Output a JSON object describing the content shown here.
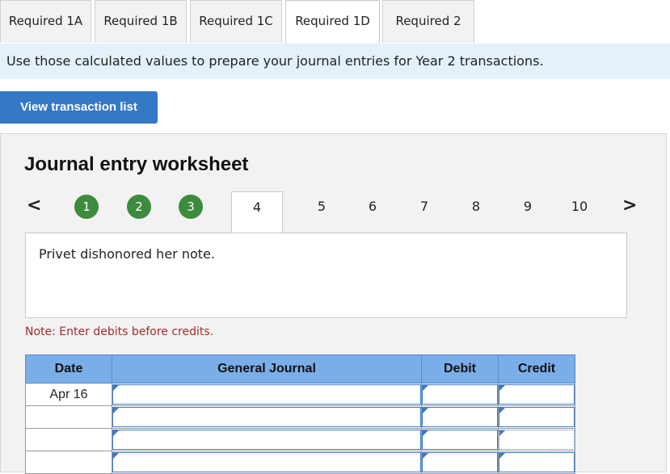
{
  "tabs": [
    "Required 1A",
    "Required 1B",
    "Required 1C",
    "Required 1D",
    "Required 2"
  ],
  "active_tab": "Required 1D",
  "instruction": "Use those calculated values to prepare your journal entries for Year 2 transactions.",
  "view_button_label": "View transaction list",
  "worksheet": {
    "title": "Journal entry worksheet",
    "prev_arrow": "<",
    "next_arrow": ">",
    "steps": [
      "1",
      "2",
      "3",
      "4",
      "5",
      "6",
      "7",
      "8",
      "9",
      "10"
    ],
    "completed_steps": [
      "1",
      "2",
      "3"
    ],
    "current_step": "4",
    "description": "Privet dishonored her note.",
    "note": "Note: Enter debits before credits."
  },
  "table": {
    "headers": [
      "Date",
      "General Journal",
      "Debit",
      "Credit"
    ],
    "rows": [
      {
        "date": "Apr 16",
        "account": "",
        "debit": "",
        "credit": ""
      },
      {
        "date": "",
        "account": "",
        "debit": "",
        "credit": ""
      },
      {
        "date": "",
        "account": "",
        "debit": "",
        "credit": ""
      },
      {
        "date": "",
        "account": "",
        "debit": "",
        "credit": ""
      }
    ]
  },
  "colors": {
    "button_blue": "#3478c6",
    "header_blue": "#7aaee8",
    "step_green": "#3d8b3d",
    "note_red": "#a52a2a",
    "instruction_bg": "#e4f1fb"
  }
}
